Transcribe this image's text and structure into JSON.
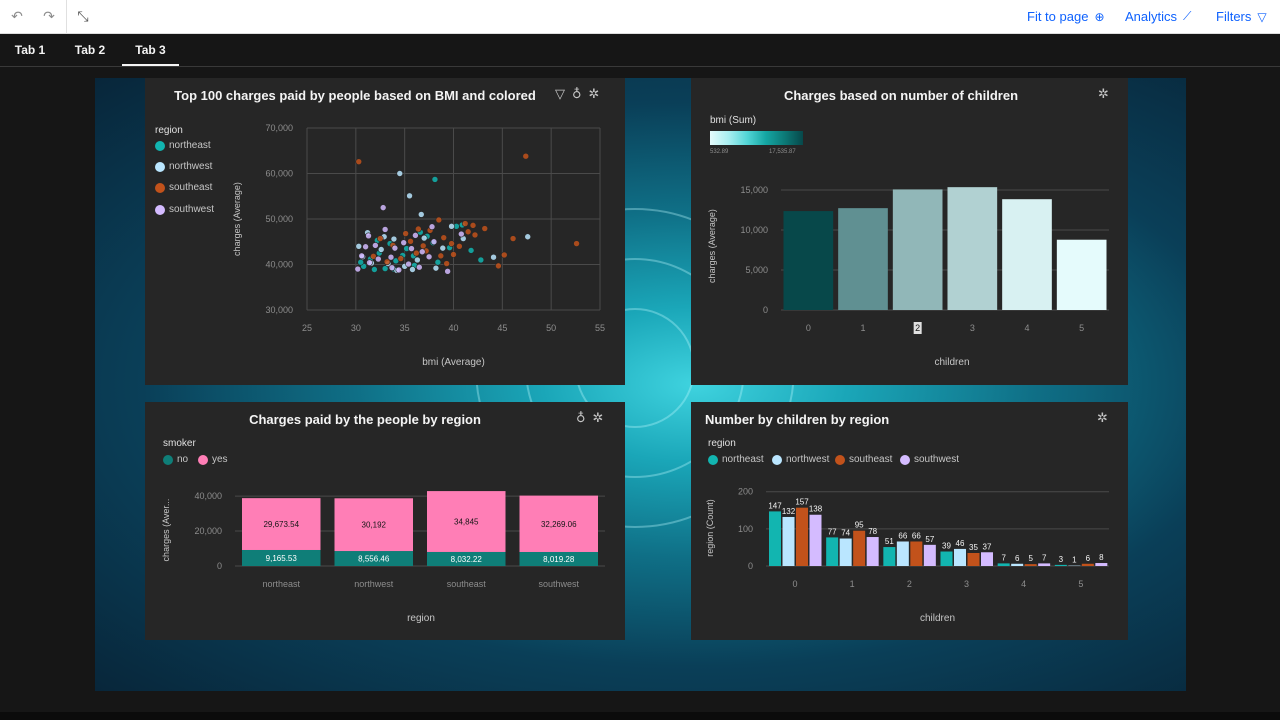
{
  "toolbar": {
    "undo_icon": "undo-icon",
    "redo_icon": "redo-icon",
    "collapse_icon": "collapse-icon",
    "fit_label": "Fit to page",
    "analytics_label": "Analytics",
    "filters_label": "Filters"
  },
  "tabs": [
    {
      "label": "Tab 1"
    },
    {
      "label": "Tab 2"
    },
    {
      "label": "Tab 3",
      "active": true
    }
  ],
  "colors": {
    "northeast": "#12b5b0",
    "northwest": "#bae6ff",
    "southeast": "#c2521b",
    "southwest": "#d4bbff",
    "smoker_no": "#0f7e78",
    "smoker_yes": "#ff7eb6"
  },
  "panels": {
    "scatter": {
      "title": "Top 100 charges paid by people based on BMI and colored",
      "legend_title": "region",
      "legend": [
        "northeast",
        "northwest",
        "southeast",
        "southwest"
      ]
    },
    "children_bar": {
      "title": "Charges based on number of children",
      "legend_title": "bmi (Sum)",
      "legend_min": "532.89",
      "legend_max": "17,535.87"
    },
    "region_bar": {
      "title": "Charges paid by the people by region",
      "legend_title": "smoker",
      "legend": [
        "no",
        "yes"
      ]
    },
    "count_bar": {
      "title": "Number by children by region",
      "legend_title": "region",
      "legend": [
        "northeast",
        "northwest",
        "southeast",
        "southwest"
      ]
    }
  },
  "chart_data": [
    {
      "type": "scatter",
      "title": "Top 100 charges paid by people based on BMI and colored",
      "xlabel": "bmi (Average)",
      "ylabel": "charges (Average)",
      "xlim": [
        25,
        55
      ],
      "ylim": [
        30000,
        70000
      ],
      "xticks": [
        25,
        30,
        35,
        40,
        45,
        50,
        55
      ],
      "yticks": [
        "30,000",
        "40,000",
        "50,000",
        "60,000",
        "70,000"
      ],
      "grid": true,
      "legend_placement": "left",
      "series": [
        {
          "name": "northeast",
          "points": [
            [
              38.1,
              58700
            ],
            [
              30.8,
              39600
            ],
            [
              31.5,
              41200
            ],
            [
              32.4,
              42500
            ],
            [
              33.0,
              39100
            ],
            [
              34.1,
              40800
            ],
            [
              35.2,
              43500
            ],
            [
              36.0,
              39800
            ],
            [
              36.6,
              47100
            ],
            [
              37.3,
              46200
            ],
            [
              38.4,
              40500
            ],
            [
              39.6,
              43700
            ],
            [
              40.3,
              48400
            ],
            [
              41.8,
              43100
            ],
            [
              42.8,
              41000
            ],
            [
              31.9,
              38900
            ],
            [
              33.5,
              44600
            ],
            [
              34.8,
              42000
            ],
            [
              30.5,
              40500
            ],
            [
              37.9,
              44800
            ],
            [
              35.9,
              41900
            ],
            [
              33.9,
              39000
            ],
            [
              40.9,
              48700
            ],
            [
              32.2,
              45300
            ]
          ]
        },
        {
          "name": "northwest",
          "points": [
            [
              34.5,
              60000
            ],
            [
              35.5,
              55100
            ],
            [
              36.7,
              51000
            ],
            [
              31.2,
              47000
            ],
            [
              30.3,
              44000
            ],
            [
              32.6,
              43300
            ],
            [
              33.3,
              40200
            ],
            [
              34.2,
              38700
            ],
            [
              35.0,
              39600
            ],
            [
              36.3,
              41000
            ],
            [
              38.2,
              39200
            ],
            [
              41.0,
              45700
            ],
            [
              47.6,
              46100
            ],
            [
              44.1,
              41600
            ],
            [
              37.0,
              45800
            ],
            [
              39.8,
              48400
            ],
            [
              31.6,
              40300
            ],
            [
              33.9,
              45600
            ],
            [
              35.8,
              38900
            ],
            [
              38.9,
              43600
            ],
            [
              30.7,
              41700
            ],
            [
              32.9,
              46100
            ]
          ]
        },
        {
          "name": "southeast",
          "points": [
            [
              30.3,
              62600
            ],
            [
              47.4,
              63800
            ],
            [
              52.6,
              44600
            ],
            [
              46.1,
              45700
            ],
            [
              45.2,
              42100
            ],
            [
              44.6,
              39700
            ],
            [
              43.2,
              47900
            ],
            [
              42.2,
              46500
            ],
            [
              41.5,
              47200
            ],
            [
              40.6,
              44000
            ],
            [
              39.8,
              44600
            ],
            [
              39.0,
              45900
            ],
            [
              38.5,
              49800
            ],
            [
              37.6,
              47500
            ],
            [
              36.9,
              44100
            ],
            [
              36.2,
              42500
            ],
            [
              35.6,
              45100
            ],
            [
              34.6,
              41300
            ],
            [
              33.8,
              44200
            ],
            [
              33.2,
              40600
            ],
            [
              32.5,
              45700
            ],
            [
              31.8,
              41800
            ],
            [
              37.2,
              43000
            ],
            [
              38.7,
              41900
            ],
            [
              40.0,
              42200
            ],
            [
              42.0,
              48600
            ],
            [
              41.2,
              49000
            ],
            [
              36.4,
              47800
            ],
            [
              39.3,
              40200
            ],
            [
              35.1,
              46800
            ]
          ]
        },
        {
          "name": "southwest",
          "points": [
            [
              32.8,
              52500
            ],
            [
              31.3,
              46300
            ],
            [
              30.2,
              39000
            ],
            [
              30.6,
              41900
            ],
            [
              31.4,
              40400
            ],
            [
              32.0,
              44200
            ],
            [
              33.7,
              39300
            ],
            [
              34.4,
              38800
            ],
            [
              35.4,
              40100
            ],
            [
              36.5,
              39400
            ],
            [
              37.5,
              41700
            ],
            [
              39.4,
              38500
            ],
            [
              40.8,
              46700
            ],
            [
              33.0,
              47700
            ],
            [
              34.0,
              43600
            ],
            [
              36.1,
              46400
            ],
            [
              37.8,
              48300
            ],
            [
              32.3,
              41200
            ],
            [
              34.9,
              44800
            ],
            [
              38.0,
              45000
            ],
            [
              35.7,
              43500
            ],
            [
              31.0,
              43900
            ],
            [
              33.6,
              41600
            ],
            [
              36.8,
              42800
            ]
          ]
        }
      ]
    },
    {
      "type": "bar",
      "title": "Charges based on number of children",
      "xlabel": "children",
      "ylabel": "charges (Average)",
      "categories": [
        "0",
        "1",
        "2",
        "3",
        "4",
        "5"
      ],
      "values": [
        12366,
        12731,
        15074,
        15355,
        13851,
        8786
      ],
      "color_values": [
        17535.87,
        10700,
        7000,
        4500,
        1500,
        532.89
      ],
      "ylim": [
        0,
        16500
      ],
      "yticks": [
        "0",
        "5,000",
        "10,000",
        "15,000"
      ],
      "selected_category": "2"
    },
    {
      "type": "bar",
      "title": "Charges paid by the people by region",
      "xlabel": "region",
      "ylabel": "charges (Aver...",
      "categories": [
        "northeast",
        "northwest",
        "southeast",
        "southwest"
      ],
      "ylim": [
        0,
        43500
      ],
      "yticks": [
        "0",
        "20,000",
        "40,000"
      ],
      "stacked": true,
      "series": [
        {
          "name": "no",
          "values": [
            9165.53,
            8556.46,
            8032.22,
            8019.28
          ],
          "labels": [
            "9,165.53",
            "8,556.46",
            "8,032.22",
            "8,019.28"
          ]
        },
        {
          "name": "yes",
          "values": [
            29673.54,
            30192,
            34845,
            32269.06
          ],
          "labels": [
            "29,673.54",
            "30,192",
            "34,845",
            "32,269.06"
          ]
        }
      ]
    },
    {
      "type": "bar",
      "title": "Number by children by region",
      "xlabel": "children",
      "ylabel": "region (Count)",
      "categories": [
        "0",
        "1",
        "2",
        "3",
        "4",
        "5"
      ],
      "ylim": [
        0,
        210
      ],
      "yticks": [
        "0",
        "100",
        "200"
      ],
      "series": [
        {
          "name": "northeast",
          "values": [
            147,
            77,
            51,
            39,
            7,
            3
          ]
        },
        {
          "name": "northwest",
          "values": [
            132,
            74,
            66,
            46,
            6,
            1
          ]
        },
        {
          "name": "southeast",
          "values": [
            157,
            95,
            66,
            35,
            5,
            6
          ]
        },
        {
          "name": "southwest",
          "values": [
            138,
            78,
            57,
            37,
            7,
            8
          ]
        }
      ],
      "data_labels": [
        [
          147,
          157
        ],
        [
          77,
          74,
          95,
          78
        ],
        [
          51,
          66,
          66,
          57
        ],
        [
          39,
          46,
          35,
          37
        ],
        [
          7,
          6,
          5,
          7
        ],
        [
          3,
          1,
          6,
          8
        ]
      ]
    }
  ]
}
